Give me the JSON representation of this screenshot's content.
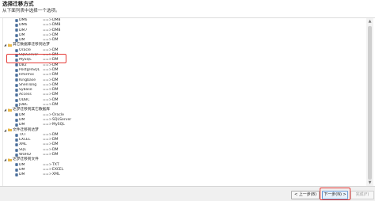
{
  "header": {
    "title": "选择迁移方式",
    "subtitle": "从下面列表中选择一个选项。"
  },
  "colors": {
    "db_icon": "#4a6e9a",
    "folder_icon": "#e8b84a",
    "highlight": "#e53935"
  },
  "tree": {
    "arrow": "==>",
    "expander": "◢",
    "db_icon": "database-icon",
    "folder_icon": "folder-icon",
    "entries": [
      {
        "kind": "item",
        "source": "DM6",
        "target": "DM8"
      },
      {
        "kind": "item",
        "source": "DM6",
        "target": "DM8"
      },
      {
        "kind": "item",
        "source": "DM7",
        "target": "DM8"
      },
      {
        "kind": "item",
        "source": "DM",
        "target": "DM"
      },
      {
        "kind": "item",
        "source": "DM",
        "target": "DM"
      },
      {
        "kind": "group",
        "label": "其它数据库迁移到达梦"
      },
      {
        "kind": "item",
        "source": "Oracle",
        "target": "DM"
      },
      {
        "kind": "item",
        "source": "SQLServer",
        "target": "DM"
      },
      {
        "kind": "item",
        "source": "MySQL",
        "target": "DM"
      },
      {
        "kind": "item",
        "source": "DB2",
        "target": "DM"
      },
      {
        "kind": "item",
        "source": "PostgreSQL",
        "target": "DM"
      },
      {
        "kind": "item",
        "source": "Informix",
        "target": "DM"
      },
      {
        "kind": "item",
        "source": "Kingbase",
        "target": "DM"
      },
      {
        "kind": "item",
        "source": "ShenTong",
        "target": "DM"
      },
      {
        "kind": "item",
        "source": "Sybase",
        "target": "DM"
      },
      {
        "kind": "item",
        "source": "Access",
        "target": "DM"
      },
      {
        "kind": "item",
        "source": "ODBC",
        "target": "DM"
      },
      {
        "kind": "item",
        "source": "JDBC",
        "target": "DM"
      },
      {
        "kind": "group",
        "label": "达梦迁移到其它数据库"
      },
      {
        "kind": "item",
        "source": "DM",
        "target": "Oracle"
      },
      {
        "kind": "item",
        "source": "DM",
        "target": "SQLServer"
      },
      {
        "kind": "item",
        "source": "DM",
        "target": "MySQL"
      },
      {
        "kind": "group",
        "label": "文件迁移到达梦"
      },
      {
        "kind": "item",
        "source": "TXT",
        "target": "DM"
      },
      {
        "kind": "item",
        "source": "EXCEL",
        "target": "DM"
      },
      {
        "kind": "item",
        "source": "XML",
        "target": "DM"
      },
      {
        "kind": "item",
        "source": "SQL",
        "target": "DM"
      },
      {
        "kind": "item",
        "source": "WORD",
        "target": "DM"
      },
      {
        "kind": "group",
        "label": "达梦迁移到文件"
      },
      {
        "kind": "item",
        "source": "DM",
        "target": "TXT"
      },
      {
        "kind": "item",
        "source": "DM",
        "target": "EXCEL"
      },
      {
        "kind": "item",
        "source": "DM",
        "target": "XML"
      }
    ]
  },
  "scrollbar": {
    "up": "▲",
    "down": "▼"
  },
  "footer": {
    "prev_label": "< 上一步(B)",
    "next_label": "下一步(N) >",
    "finish_label": "完成(F)"
  }
}
